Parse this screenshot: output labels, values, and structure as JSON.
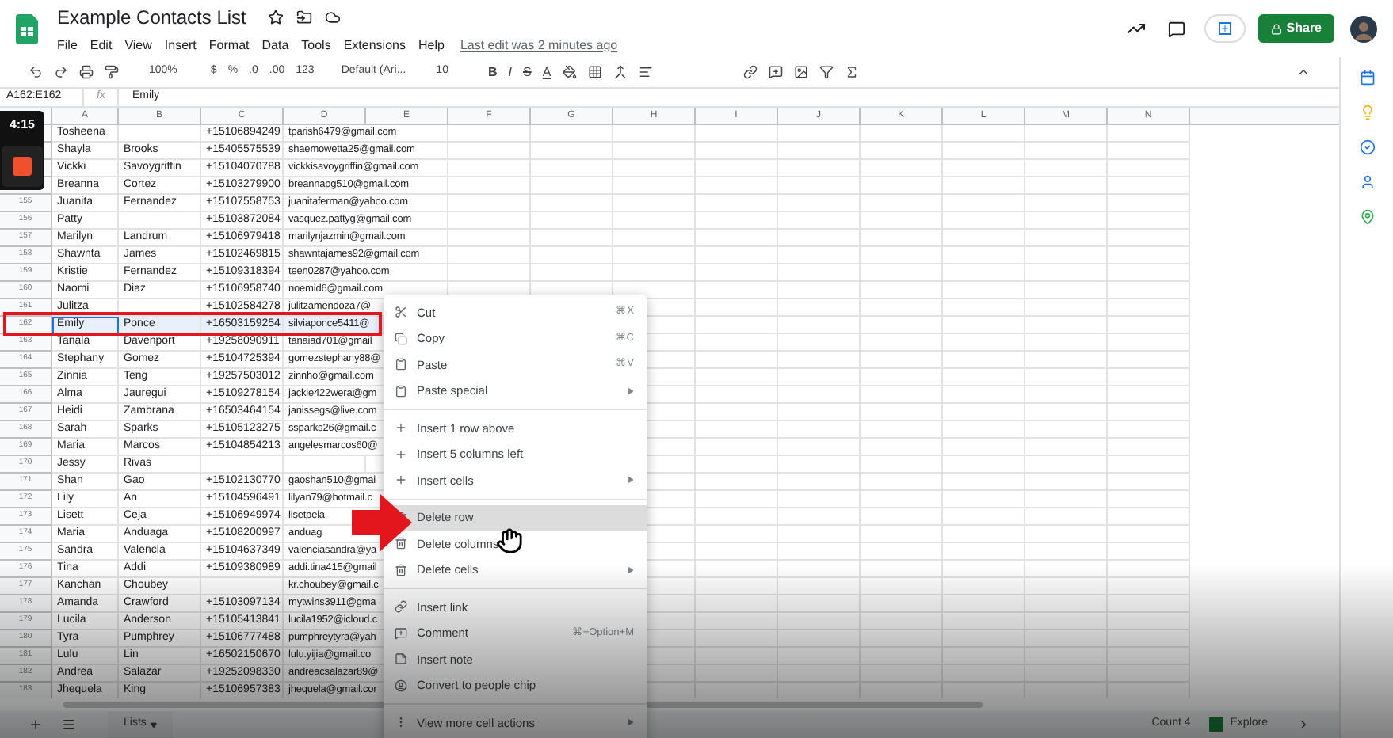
{
  "header": {
    "title": "Example Contacts List",
    "menus": [
      "File",
      "Edit",
      "View",
      "Insert",
      "Format",
      "Data",
      "Tools",
      "Extensions",
      "Help"
    ],
    "last_edit": "Last edit was 2 minutes ago",
    "share": "Share"
  },
  "toolbar": {
    "zoom": "100%",
    "currency": "$",
    "percent": "%",
    "decrease_decimal": ".0",
    "increase_decimal": ".00",
    "format": "123",
    "font": "Default (Ari...",
    "size": "10",
    "bold": "B",
    "italic": "I",
    "strike": "S",
    "text_color": "A"
  },
  "formula_bar": {
    "range": "A162:E162",
    "fx": "fx",
    "value": "Emily"
  },
  "columns": [
    "A",
    "B",
    "C",
    "D",
    "E",
    "F",
    "G",
    "H",
    "I",
    "J",
    "K",
    "L",
    "M",
    "N"
  ],
  "rows": [
    {
      "first": "Tosheena",
      "last": "",
      "phone": "+15106894249",
      "email": "tparish6479@gmail.com",
      "selected": false
    },
    {
      "first": "Shayla",
      "last": "Brooks",
      "phone": "+15405575539",
      "email": "shaemowetta25@gmail.com",
      "selected": false
    },
    {
      "first": "Vickki",
      "last": "Savoygriffin",
      "phone": "+15104070788",
      "email": "vickkisavoygriffin@gmail.com",
      "selected": false
    },
    {
      "first": "Breanna",
      "last": "Cortez",
      "phone": "+15103279900",
      "email": "breannapg510@gmail.com",
      "selected": false
    },
    {
      "num": "155",
      "first": "Juanita",
      "last": "Fernandez",
      "phone": "+15107558753",
      "email": "juanitaferman@yahoo.com",
      "selected": false
    },
    {
      "num": "156",
      "first": "Patty",
      "last": "",
      "phone": "+15103872084",
      "email": "vasquez.pattyg@gmail.com",
      "selected": false
    },
    {
      "num": "157",
      "first": "Marilyn",
      "last": "Landrum",
      "phone": "+15106979418",
      "email": "marilynjazmin@gmail.com",
      "selected": false
    },
    {
      "num": "158",
      "first": "Shawnta",
      "last": "James",
      "phone": "+15102469815",
      "email": "shawntajames92@gmail.com",
      "selected": false
    },
    {
      "num": "159",
      "first": "Kristie",
      "last": "Fernandez",
      "phone": "+15109318394",
      "email": "teen0287@yahoo.com",
      "selected": false
    },
    {
      "num": "160",
      "first": "Naomi",
      "last": "Diaz",
      "phone": "+15106958740",
      "email": "noemid6@gmail.com",
      "selected": false
    },
    {
      "num": "161",
      "first": "Julitza",
      "last": "",
      "phone": "+15102584278",
      "email": "julitzamendoza7@",
      "selected": false
    },
    {
      "num": "162",
      "first": "Emily",
      "last": "Ponce",
      "phone": "+16503159254",
      "email": "silviaponce5411@",
      "selected": true
    },
    {
      "num": "163",
      "first": "Tanaia",
      "last": "Davenport",
      "phone": "+19258090911",
      "email": "tanaiad701@gmail",
      "selected": false
    },
    {
      "num": "164",
      "first": "Stephany",
      "last": "Gomez",
      "phone": "+15104725394",
      "email": "gomezstephany88@",
      "selected": false
    },
    {
      "num": "165",
      "first": "Zinnia",
      "last": "Teng",
      "phone": "+19257503012",
      "email": "zinnho@gmail.com",
      "selected": false
    },
    {
      "num": "166",
      "first": "Alma",
      "last": "Jauregui",
      "phone": "+15109278154",
      "email": "jackie422wera@gm",
      "selected": false
    },
    {
      "num": "167",
      "first": "Heidi",
      "last": "Zambrana",
      "phone": "+16503464154",
      "email": "janissegs@live.com",
      "selected": false
    },
    {
      "num": "168",
      "first": "Sarah",
      "last": "Sparks",
      "phone": "+15105123275",
      "email": "ssparks26@gmail.c",
      "selected": false
    },
    {
      "num": "169",
      "first": "Maria",
      "last": "Marcos",
      "phone": "+15104854213",
      "email": "angelesmarcos60@",
      "selected": false
    },
    {
      "num": "170",
      "first": "Jessy",
      "last": "Rivas",
      "phone": "",
      "email": "",
      "selected": false
    },
    {
      "num": "171",
      "first": "Shan",
      "last": "Gao",
      "phone": "+15102130770",
      "email": "gaoshan510@gmai",
      "selected": false
    },
    {
      "num": "172",
      "first": "Lily",
      "last": "An",
      "phone": "+15104596491",
      "email": "lilyan79@hotmail.c",
      "selected": false
    },
    {
      "num": "173",
      "first": "Lisett",
      "last": "Ceja",
      "phone": "+15106949974",
      "email": "lisetpela",
      "selected": false
    },
    {
      "num": "174",
      "first": "Maria",
      "last": "Anduaga",
      "phone": "+15108200997",
      "email": "anduag",
      "selected": false
    },
    {
      "num": "175",
      "first": "Sandra",
      "last": "Valencia",
      "phone": "+15104637349",
      "email": "valenciasandra@ya",
      "selected": false
    },
    {
      "num": "176",
      "first": "Tina",
      "last": "Addi",
      "phone": "+15109380989",
      "email": "addi.tina415@gmail",
      "selected": false
    },
    {
      "num": "177",
      "first": "Kanchan",
      "last": "Choubey",
      "phone": "",
      "email": "kr.choubey@gmail.c",
      "selected": false
    },
    {
      "num": "178",
      "first": "Amanda",
      "last": "Crawford",
      "phone": "+15103097134",
      "email": "mytwins3911@gma",
      "selected": false
    },
    {
      "num": "179",
      "first": "Lucila",
      "last": "Anderson",
      "phone": "+15105413841",
      "email": "lucila1952@icloud.c",
      "selected": false
    },
    {
      "num": "180",
      "first": "Tyra",
      "last": "Pumphrey",
      "phone": "+15106777488",
      "email": "pumphreytyra@yah",
      "selected": false
    },
    {
      "num": "181",
      "first": "Lulu",
      "last": "Lin",
      "phone": "+16502150670",
      "email": "lulu.yijia@gmail.co",
      "selected": false
    },
    {
      "num": "182",
      "first": "Andrea",
      "last": "Salazar",
      "phone": "+19252098330",
      "email": "andreacsalazar89@",
      "selected": false
    },
    {
      "num": "183",
      "first": "Jhequela",
      "last": "King",
      "phone": "+15106957383",
      "email": "jhequela@gmail.cor",
      "selected": false
    }
  ],
  "context_menu": [
    [
      {
        "label": "Cut",
        "shortcut": "⌘X",
        "highlighted": false
      },
      {
        "label": "Copy",
        "shortcut": "⌘C",
        "highlighted": false
      },
      {
        "label": "Paste",
        "shortcut": "⌘V",
        "highlighted": false
      },
      {
        "label": "Paste special",
        "submenu": true,
        "highlighted": false
      }
    ],
    [
      {
        "label": "Insert 1 row above",
        "highlighted": false
      },
      {
        "label": "Insert 5 columns left",
        "highlighted": false
      },
      {
        "label": "Insert cells",
        "submenu": true,
        "highlighted": false
      }
    ],
    [
      {
        "label": "Delete row",
        "highlighted": true
      },
      {
        "label": "Delete columns",
        "highlighted": false
      },
      {
        "label": "Delete cells",
        "submenu": true,
        "highlighted": false
      }
    ],
    [
      {
        "label": "Insert link",
        "highlighted": false
      },
      {
        "label": "Comment",
        "shortcut": "⌘+Option+M",
        "highlighted": false
      },
      {
        "label": "Insert note",
        "highlighted": false
      },
      {
        "label": "Convert to people chip",
        "highlighted": false
      }
    ],
    [
      {
        "label": "View more cell actions",
        "submenu": true,
        "highlighted": false
      }
    ]
  ],
  "bottom_bar": {
    "sheet_tab": "Lists",
    "count": "Count 4",
    "explore": "Explore"
  },
  "recorder": {
    "time": "4:15"
  }
}
